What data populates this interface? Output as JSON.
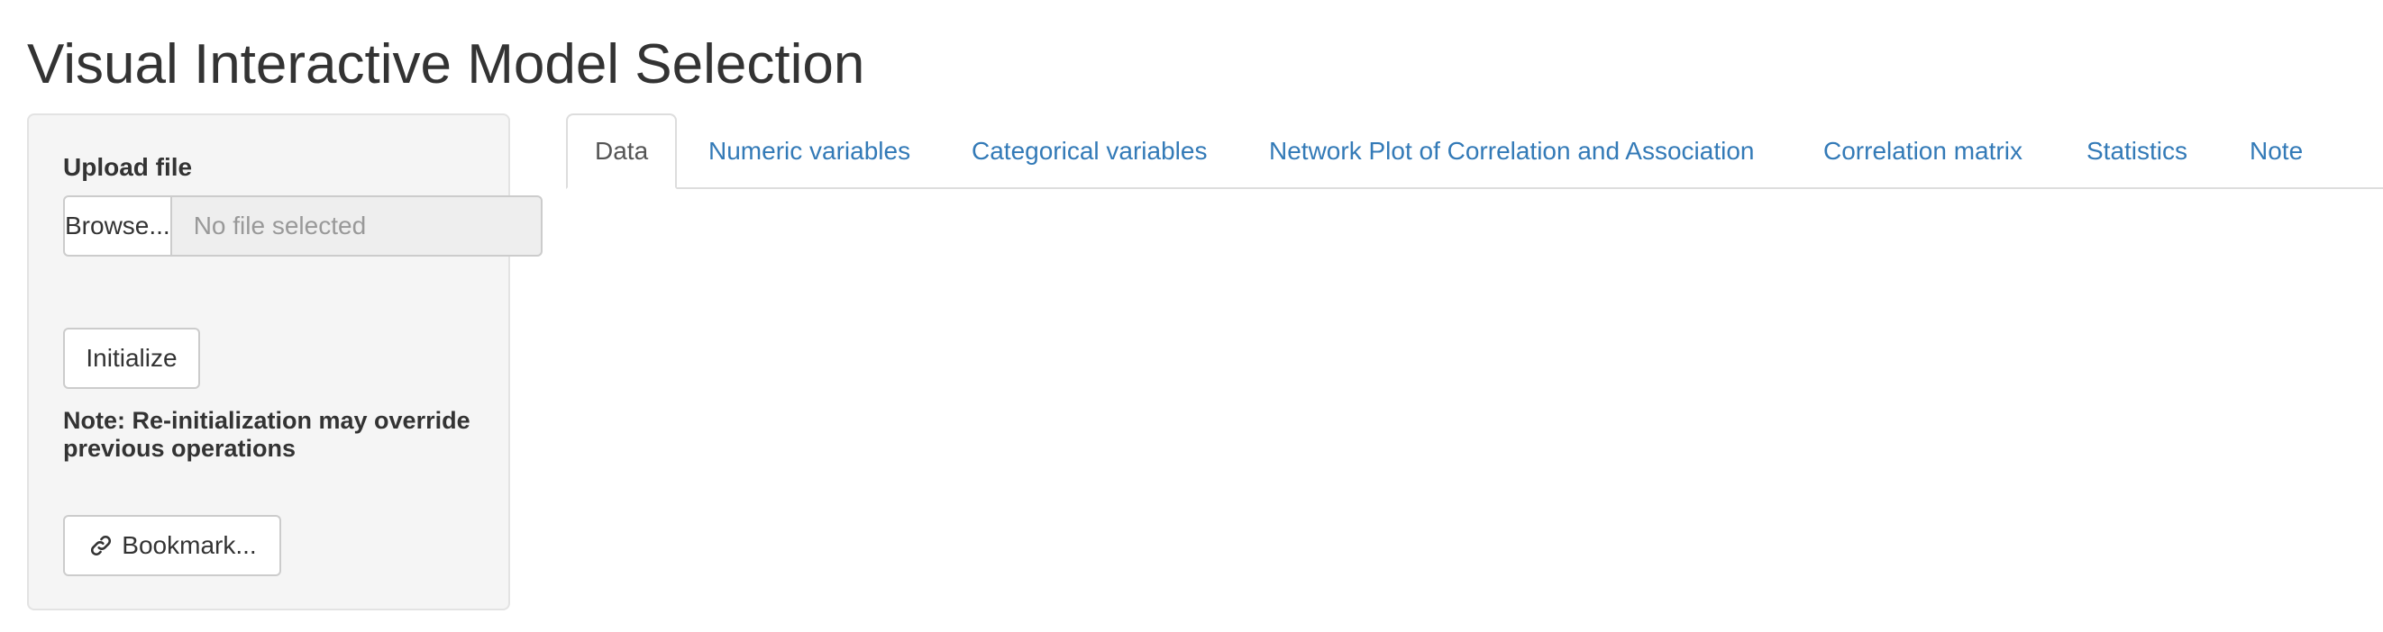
{
  "page": {
    "title": "Visual Interactive Model Selection"
  },
  "sidebar": {
    "upload_label": "Upload file",
    "browse_label": "Browse...",
    "file_placeholder": "No file selected",
    "initialize_label": "Initialize",
    "note": "Note: Re-initialization may override previous operations",
    "bookmark_label": "Bookmark...",
    "bookmark_icon": "link-icon"
  },
  "tabs": [
    {
      "label": "Data",
      "active": true
    },
    {
      "label": "Numeric variables",
      "active": false
    },
    {
      "label": "Categorical variables",
      "active": false
    },
    {
      "label": "Network Plot of Correlation and Association",
      "active": false
    },
    {
      "label": "Correlation matrix",
      "active": false
    },
    {
      "label": "Statistics",
      "active": false
    },
    {
      "label": "Note",
      "active": false
    }
  ],
  "colors": {
    "link": "#337ab7",
    "active_tab_text": "#555555",
    "sidebar_bg": "#f5f5f5"
  }
}
